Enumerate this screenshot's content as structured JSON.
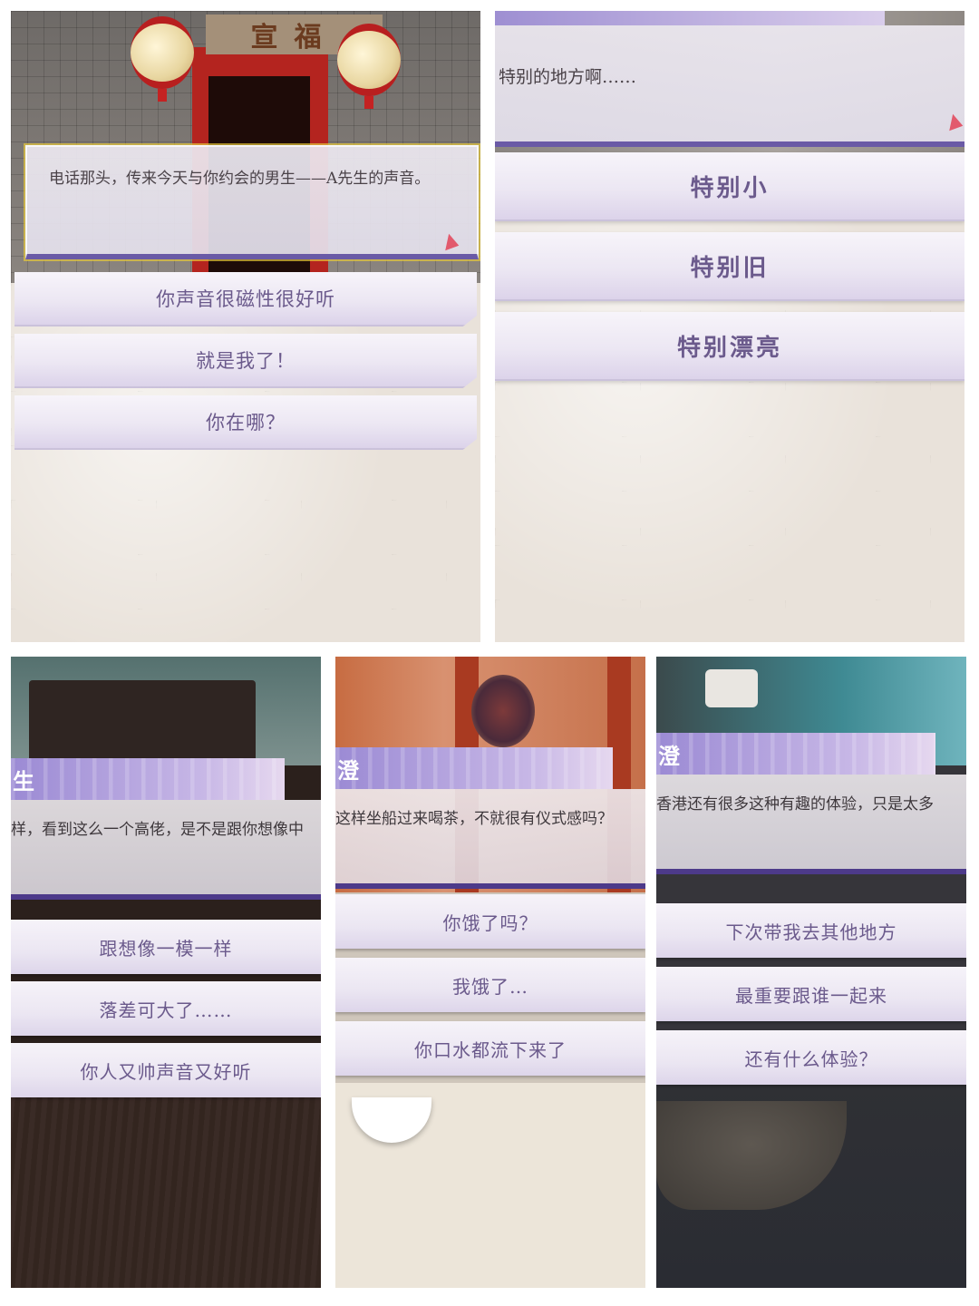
{
  "panel1": {
    "plaque": "宣福",
    "dialog": "电话那头，传来今天与你约会的男生——A先生的声音。",
    "choices": [
      "你声音很磁性很好听",
      "就是我了！",
      "你在哪？"
    ]
  },
  "panel2": {
    "dialog": "特别的地方啊……",
    "choices": [
      "特别小",
      "特别旧",
      "特别漂亮"
    ]
  },
  "panel3": {
    "name": "生",
    "dialog": "样，看到这么一个高佬，是不是跟你想像中",
    "choices": [
      "跟想像一模一样",
      "落差可大了……",
      "你人又帅声音又好听"
    ]
  },
  "panel4": {
    "name": "澄",
    "dialog": "这样坐船过来喝茶，不就很有仪式感吗？",
    "choices": [
      "你饿了吗？",
      "我饿了…",
      "你口水都流下来了"
    ]
  },
  "panel5": {
    "name": "澄",
    "dialog": "香港还有很多这种有趣的体验，只是太多",
    "choices": [
      "下次带我去其他地方",
      "最重要跟谁一起来",
      "还有什么体验？"
    ]
  },
  "colors": {
    "choice_text": "#6b5a8c",
    "dialog_border": "#6a5aa6",
    "name_bar": "#9b8ad4",
    "arrow": "#e25a6d"
  }
}
